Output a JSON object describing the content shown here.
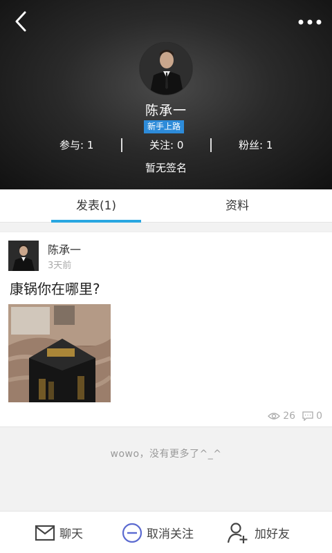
{
  "header": {
    "username": "陈承一",
    "level_badge": "新手上路",
    "stats": {
      "participate": "参与: 1",
      "following": "关注: 0",
      "fans": "粉丝: 1"
    },
    "signature": "暂无签名",
    "icons": {
      "back": "back-arrow-icon",
      "more": "more-dots-icon"
    }
  },
  "tabs": [
    {
      "label": "发表(1)",
      "active": true
    },
    {
      "label": "资料",
      "active": false
    }
  ],
  "post": {
    "author": "陈承一",
    "time": "3天前",
    "text": "康锅你在哪里?",
    "views": "26",
    "comments": "0"
  },
  "end_message": "wowo，没有更多了^_^",
  "bottom_bar": {
    "chat": "聊天",
    "unfollow": "取消关注",
    "add_friend": "加好友"
  },
  "colors": {
    "accent": "#29a7e1",
    "badge": "#2d8bd9",
    "unfollow_icon": "#5b6ad0"
  }
}
